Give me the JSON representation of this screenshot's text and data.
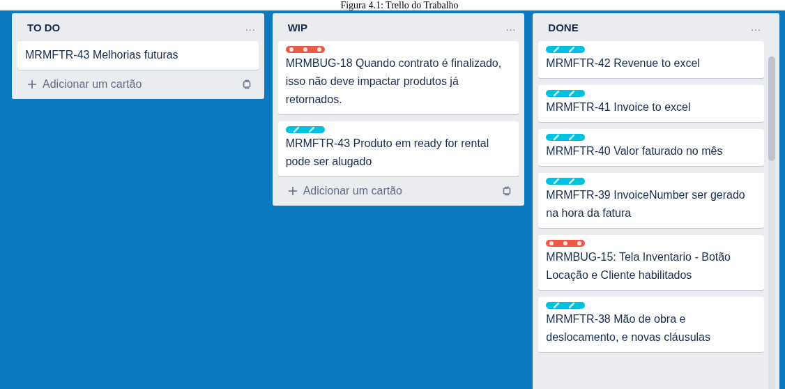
{
  "caption": "Figura 4.1: Trello do Trabalho",
  "lists": [
    {
      "title": "TO DO",
      "menu": "...",
      "add_card": "Adicionar um cartão",
      "cards": [
        {
          "text": "MRMFTR-43 Melhorias futuras"
        }
      ]
    },
    {
      "title": "WIP",
      "menu": "...",
      "add_card": "Adicionar um cartão",
      "cards": [
        {
          "label": {
            "kind": "bug",
            "color": "#eb5a46"
          },
          "text": "MRMBUG-18 Quando contrato é finalizado, isso não deve impactar produtos já retornados."
        },
        {
          "label": {
            "kind": "feature",
            "color": "#00c2e0"
          },
          "text": "MRMFTR-43 Produto em ready for rental pode ser alugado"
        }
      ]
    },
    {
      "title": "DONE",
      "menu": "...",
      "cards": [
        {
          "label": {
            "kind": "feature",
            "color": "#00c2e0"
          },
          "text": "MRMFTR-42 Revenue to excel"
        },
        {
          "label": {
            "kind": "feature",
            "color": "#00c2e0"
          },
          "text": "MRMFTR-41 Invoice to excel"
        },
        {
          "label": {
            "kind": "feature",
            "color": "#00c2e0"
          },
          "text": "MRMFTR-40 Valor faturado no mês"
        },
        {
          "label": {
            "kind": "feature",
            "color": "#00c2e0"
          },
          "text": "MRMFTR-39 InvoiceNumber ser gerado na hora da fatura"
        },
        {
          "label": {
            "kind": "bug",
            "color": "#eb5a46"
          },
          "text": "MRMBUG-15: Tela Inventario - Botão Locação e Cliente habilitados"
        },
        {
          "label": {
            "kind": "feature",
            "color": "#00c2e0"
          },
          "text": "MRMFTR-38 Mão de obra e deslocamento, e novas cláusulas"
        }
      ]
    }
  ]
}
